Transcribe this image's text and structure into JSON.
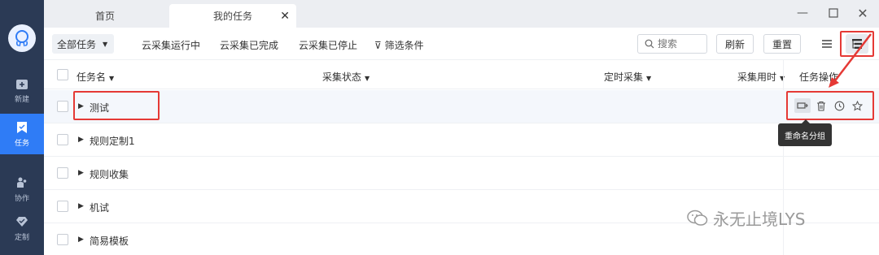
{
  "sidebar": {
    "items": [
      {
        "label": "新建",
        "icon": "plus-box-icon"
      },
      {
        "label": "任务",
        "icon": "bookmark-icon",
        "active": true
      },
      {
        "label": "协作",
        "icon": "people-icon"
      },
      {
        "label": "定制",
        "icon": "diamond-icon"
      }
    ]
  },
  "tabs": [
    {
      "label": "首页"
    },
    {
      "label": "我的任务",
      "active": true
    }
  ],
  "toolbar": {
    "scope_dropdown": "全部任务",
    "filters": [
      "云采集运行中",
      "云采集已完成",
      "云采集已停止",
      "筛选条件"
    ],
    "search_placeholder": "搜索",
    "refresh_label": "刷新",
    "reset_label": "重置"
  },
  "table": {
    "headers": {
      "name": "任务名",
      "status": "采集状态",
      "timer": "定时采集",
      "duration": "采集用时",
      "operations": "任务操作"
    },
    "rows": [
      {
        "name": "测试"
      },
      {
        "name": "规则定制1"
      },
      {
        "name": "规则收集"
      },
      {
        "name": "机试"
      },
      {
        "name": "简易模板"
      }
    ]
  },
  "tooltip": "重命名分组",
  "watermark": "永无止境LYS",
  "colors": {
    "sidebar_bg": "#2b3a55",
    "active_blue": "#2f7cf6",
    "annotation_red": "#e53935"
  }
}
